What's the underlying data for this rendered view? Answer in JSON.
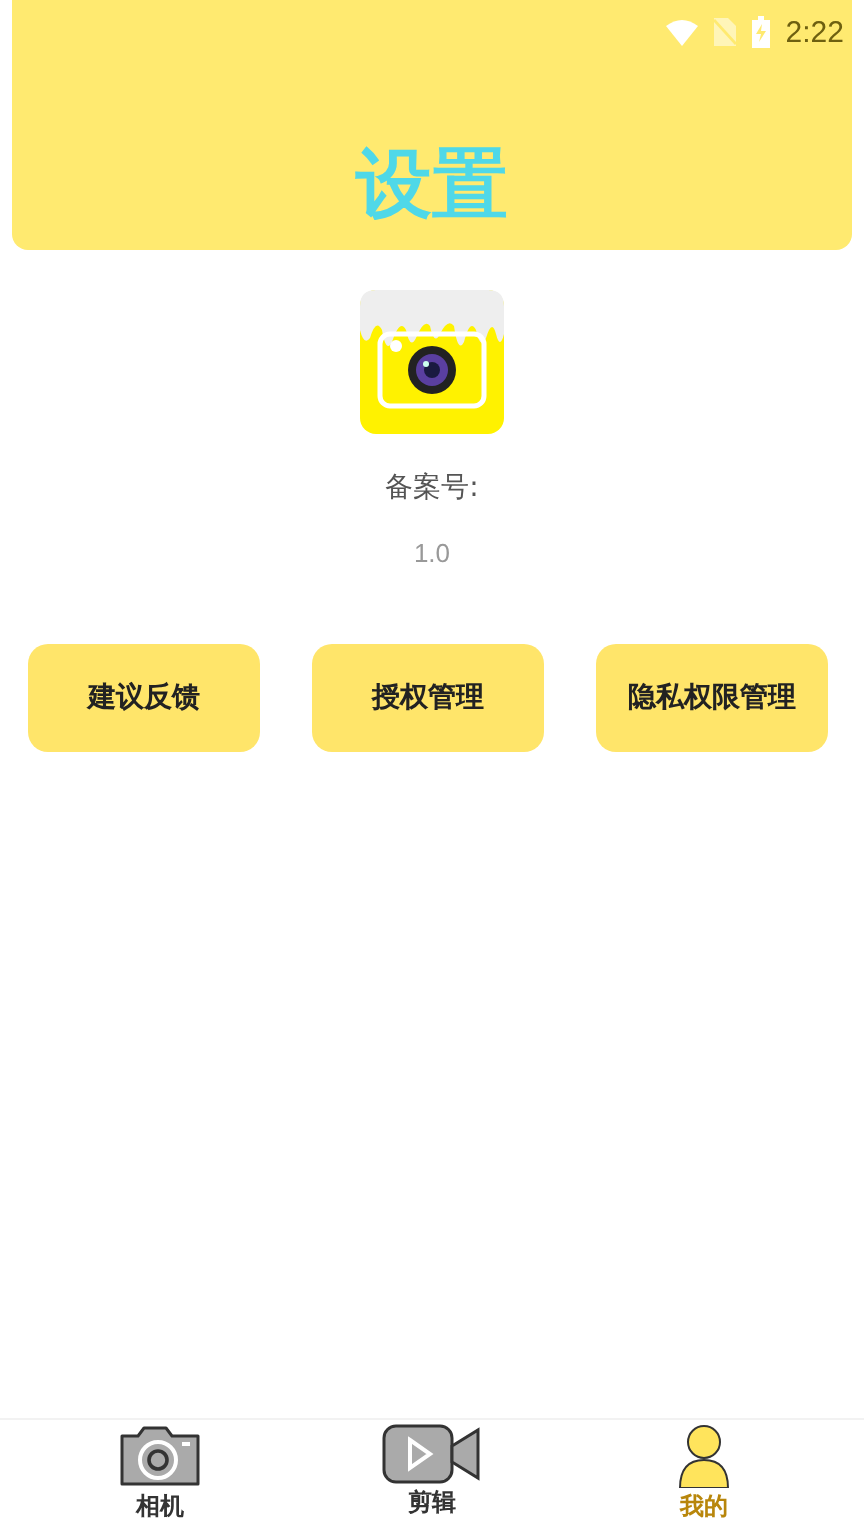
{
  "status_bar": {
    "time": "2:22"
  },
  "header": {
    "title": "设置"
  },
  "app_info": {
    "record_label": "备案号:",
    "version": "1.0"
  },
  "buttons": [
    "建议反馈",
    "授权管理",
    "隐私权限管理"
  ],
  "tabs": [
    {
      "kind": "camera",
      "label": "相机",
      "selected": false
    },
    {
      "kind": "video",
      "label": "剪辑",
      "selected": false
    },
    {
      "kind": "profile",
      "label": "我的",
      "selected": true
    }
  ]
}
